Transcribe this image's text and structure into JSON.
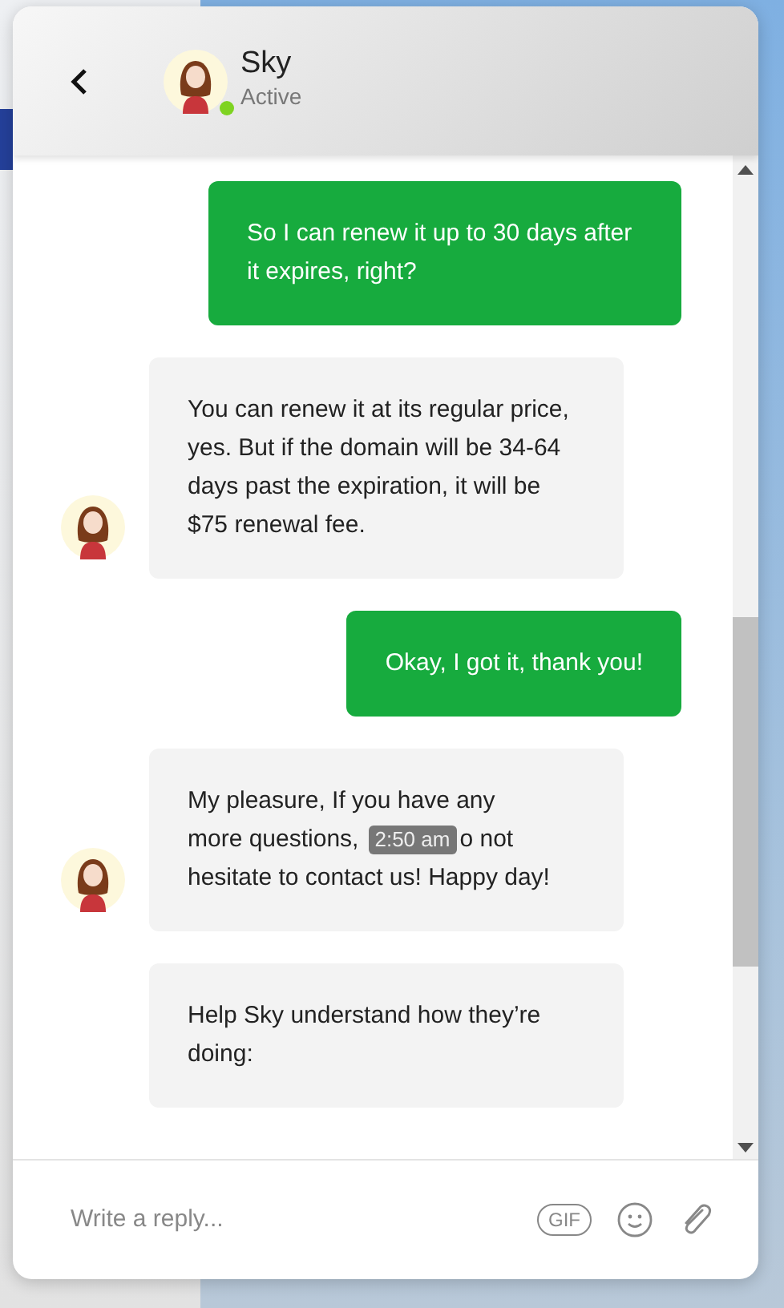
{
  "header": {
    "name": "Sky",
    "status": "Active",
    "online": true
  },
  "messages": [
    {
      "kind": "sent",
      "text": "So I can renew it up to 30 days after it expires, right?"
    },
    {
      "kind": "received",
      "text": "You can renew it at its regular price, yes. But if the domain will be 34-64 days past the expiration, it will be $75 renewal fee.",
      "show_avatar": true
    },
    {
      "kind": "sent",
      "text": "Okay, I got it, thank you!"
    },
    {
      "kind": "received",
      "text": "My pleasure, If you have any",
      "text_mid": "more questions,",
      "timestamp": "2:50 am",
      "text_after": "o not",
      "text_end": "hesitate to contact us! Happy day!",
      "show_avatar": true
    },
    {
      "kind": "received",
      "text": "Help Sky understand how they’re doing:",
      "show_avatar": false
    }
  ],
  "composer": {
    "placeholder": "Write a reply...",
    "gif_label": "GIF"
  }
}
